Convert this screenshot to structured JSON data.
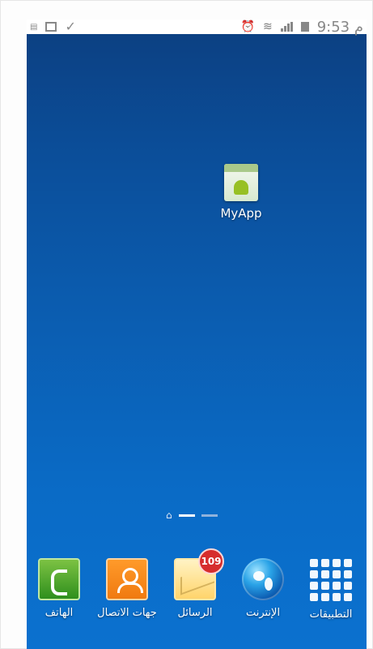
{
  "status_bar": {
    "time": "9:53 م"
  },
  "home": {
    "app": {
      "name": "MyApp",
      "icon": "android-app-icon"
    },
    "page_indicator": {
      "home_icon": "home-icon",
      "pages": 2,
      "active_index": 0
    }
  },
  "dock": {
    "items": [
      {
        "label": "الهاتف",
        "icon": "phone-icon"
      },
      {
        "label": "جهات الاتصال",
        "icon": "contacts-icon"
      },
      {
        "label": "الرسائل",
        "icon": "messages-icon",
        "badge": "109"
      },
      {
        "label": "الإنترنت",
        "icon": "globe-icon"
      },
      {
        "label": "التطبيقات",
        "icon": "apps-grid-icon"
      }
    ]
  },
  "colors": {
    "wallpaper_top": "#0c3f80",
    "wallpaper_bottom": "#0b71cf",
    "badge_red": "#d62d2d"
  }
}
